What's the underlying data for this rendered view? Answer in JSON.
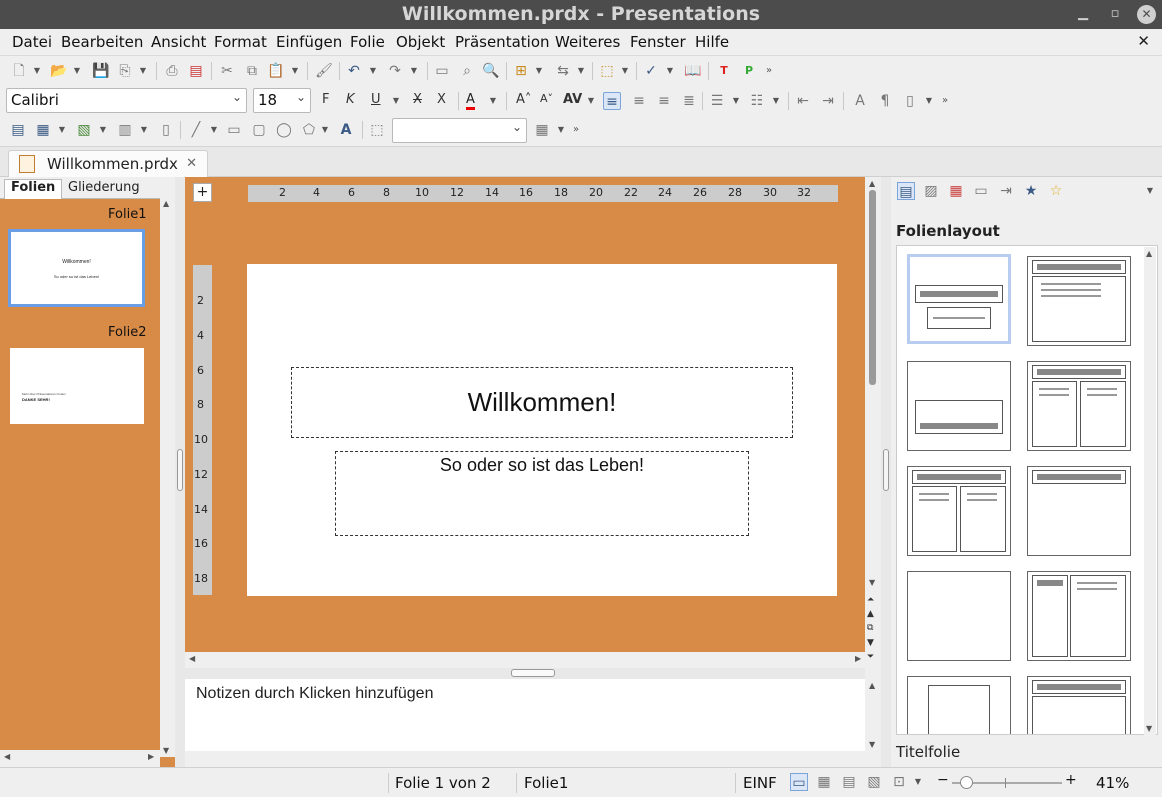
{
  "window": {
    "title": "Willkommen.prdx - Presentations"
  },
  "menu": [
    "Datei",
    "Bearbeiten",
    "Ansicht",
    "Format",
    "Einfügen",
    "Folie",
    "Objekt",
    "Präsentation",
    "Weiteres",
    "Fenster",
    "Hilfe"
  ],
  "format_toolbar": {
    "font_name": "Calibri",
    "font_size": "18"
  },
  "document_tab": {
    "label": "Willkommen.prdx"
  },
  "slide_panel": {
    "tabs": [
      "Folien",
      "Gliederung"
    ],
    "slides": [
      {
        "label": "Folie1",
        "title": "Willkommen!",
        "subtitle": "So oder so ist das Leben!"
      },
      {
        "label": "Folie2",
        "line1": "Mehr über Präsentationen finden",
        "line2": "DANKE SEHR!"
      }
    ]
  },
  "rulers": {
    "horizontal": [
      "2",
      "4",
      "6",
      "8",
      "10",
      "12",
      "14",
      "16",
      "18",
      "20",
      "22",
      "24",
      "26",
      "28",
      "30",
      "32"
    ],
    "vertical": [
      "2",
      "4",
      "6",
      "8",
      "10",
      "12",
      "14",
      "16",
      "18"
    ]
  },
  "slide": {
    "title": "Willkommen!",
    "subtitle": "So oder so ist das Leben!"
  },
  "notes": {
    "placeholder": "Notizen durch Klicken hinzufügen"
  },
  "sidebar": {
    "heading": "Folienlayout",
    "selected_layout": "Titelfolie"
  },
  "status": {
    "slide_pos": "Folie 1 von 2",
    "slide_name": "Folie1",
    "mode": "EINF",
    "zoom": "41%"
  },
  "colors": {
    "workspace": "#d88b47",
    "selection": "#6a9ee4"
  }
}
